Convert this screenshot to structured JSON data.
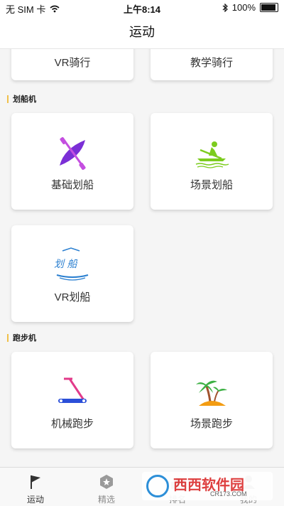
{
  "status_bar": {
    "carrier": "无 SIM 卡",
    "time": "上午8:14",
    "battery": "100%"
  },
  "nav": {
    "title": "运动"
  },
  "cards_top": [
    {
      "label": "VR骑行"
    },
    {
      "label": "教学骑行"
    }
  ],
  "sections": [
    {
      "title": "划船机",
      "cards": [
        {
          "label": "基础划船",
          "icon": "kayak-paddle-icon"
        },
        {
          "label": "场景划船",
          "icon": "rower-on-water-icon"
        },
        {
          "label": "VR划船",
          "icon": "vr-rowing-logo-icon",
          "logo_text": "划 船"
        }
      ]
    },
    {
      "title": "跑步机",
      "cards": [
        {
          "label": "机械跑步",
          "icon": "treadmill-icon"
        },
        {
          "label": "场景跑步",
          "icon": "palm-island-icon"
        }
      ]
    }
  ],
  "tabs": [
    {
      "label": "运动",
      "icon": "flag-icon",
      "active": true
    },
    {
      "label": "精选",
      "icon": "star-badge-icon",
      "active": false
    },
    {
      "label": "排名",
      "icon": "ranking-icon",
      "active": false
    },
    {
      "label": "我的",
      "icon": "person-icon",
      "active": false
    }
  ],
  "watermark": {
    "brand": "西西软件园",
    "url": "CR173.COM"
  },
  "colors": {
    "accent_bar": "#f0c04a",
    "kayak_purple": "#7b2fd6",
    "rower_green": "#7ccc1e",
    "treadmill_blue": "#2b4fd8",
    "treadmill_pink": "#e23b8a",
    "palm_green": "#3cb043",
    "island_orange": "#f39c12"
  }
}
